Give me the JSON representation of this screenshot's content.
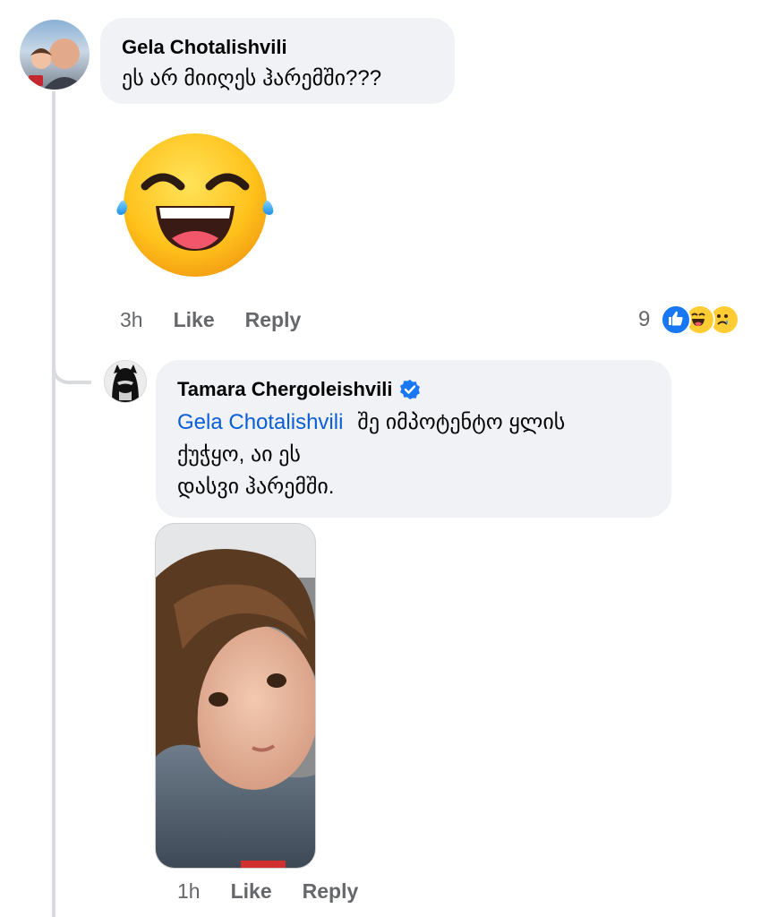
{
  "comment_1": {
    "author": "Gela Chotalishvili",
    "text": "ეს არ მიიღეს ჰარემში???",
    "time": "3h",
    "like_label": "Like",
    "reply_label": "Reply",
    "reaction_count": "9",
    "sticker": "laughing-tears-emoji"
  },
  "reply_1": {
    "author": "Tamara Chergoleishvili",
    "verified": true,
    "mention": "Gela Chotalishvili",
    "text_line1": "შე იმპოტენტო ყლის",
    "text_line2": "ქუჭყო, აი ეს",
    "text_line3": "დასვი ჰარემში.",
    "time": "1h",
    "like_label": "Like",
    "reply_label": "Reply"
  },
  "colors": {
    "bubble": "#f0f2f5",
    "link": "#0a5ed8",
    "like_blue": "#1877f2",
    "meta": "#65676b"
  }
}
